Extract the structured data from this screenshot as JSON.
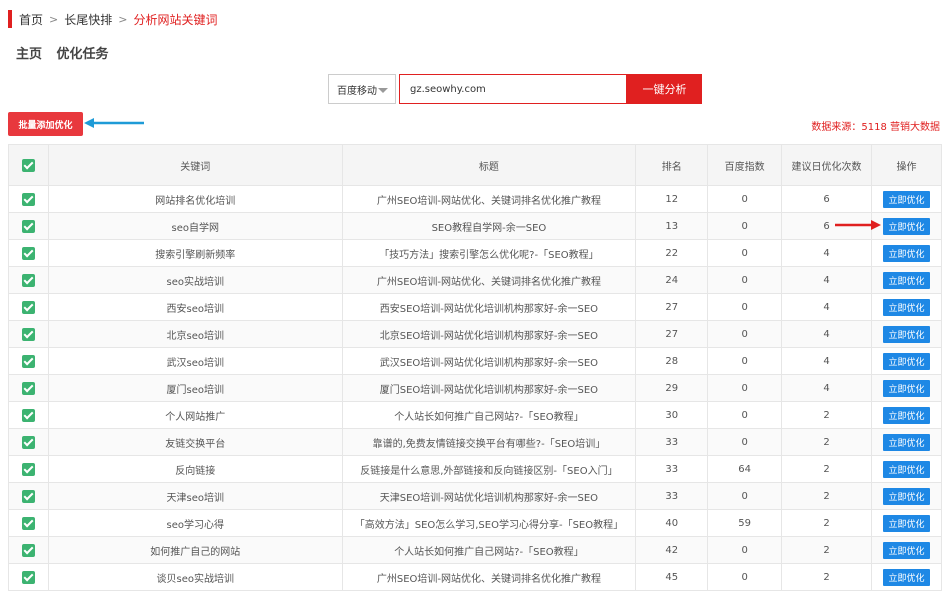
{
  "breadcrumb": {
    "home": "首页",
    "section": "长尾快排",
    "current": "分析网站关键词"
  },
  "page_tabs": [
    "主页",
    "优化任务"
  ],
  "search": {
    "engine": "百度移动",
    "url": "gz.seowhy.com",
    "submit_label": "一键分析"
  },
  "batch_add_label": "批量添加优化",
  "data_source": "数据来源：5118 营销大数据",
  "colors": {
    "accent": "#e02020",
    "action": "#1e88e5",
    "check": "#3cb371",
    "arrow_blue": "#1e9bd7"
  },
  "table": {
    "headers": [
      "关键词",
      "标题",
      "排名",
      "百度指数",
      "建议日优化次数",
      "操作"
    ],
    "action_label": "立即优化",
    "rows": [
      {
        "keyword": "网站排名优化培训",
        "title": "广州SEO培训-网站优化、关键词排名优化推广教程",
        "rank": "12",
        "index": "0",
        "times": "6"
      },
      {
        "keyword": "seo自学网",
        "title": "SEO教程自学网-余一SEO",
        "rank": "13",
        "index": "0",
        "times": "6"
      },
      {
        "keyword": "搜索引擎刷新频率",
        "title": "「技巧方法」搜索引擎怎么优化呢?-「SEO教程」",
        "rank": "22",
        "index": "0",
        "times": "4"
      },
      {
        "keyword": "seo实战培训",
        "title": "广州SEO培训-网站优化、关键词排名优化推广教程",
        "rank": "24",
        "index": "0",
        "times": "4"
      },
      {
        "keyword": "西安seo培训",
        "title": "西安SEO培训-网站优化培训机构那家好-余一SEO",
        "rank": "27",
        "index": "0",
        "times": "4"
      },
      {
        "keyword": "北京seo培训",
        "title": "北京SEO培训-网站优化培训机构那家好-余一SEO",
        "rank": "27",
        "index": "0",
        "times": "4"
      },
      {
        "keyword": "武汉seo培训",
        "title": "武汉SEO培训-网站优化培训机构那家好-余一SEO",
        "rank": "28",
        "index": "0",
        "times": "4"
      },
      {
        "keyword": "厦门seo培训",
        "title": "厦门SEO培训-网站优化培训机构那家好-余一SEO",
        "rank": "29",
        "index": "0",
        "times": "4"
      },
      {
        "keyword": "个人网站推广",
        "title": "个人站长如何推广自己网站?-「SEO教程」",
        "rank": "30",
        "index": "0",
        "times": "2"
      },
      {
        "keyword": "友链交换平台",
        "title": "靠谱的,免费友情链接交换平台有哪些?-「SEO培训」",
        "rank": "33",
        "index": "0",
        "times": "2"
      },
      {
        "keyword": "反向链接",
        "title": "反链接是什么意思,外部链接和反向链接区别-「SEO入门」",
        "rank": "33",
        "index": "64",
        "times": "2"
      },
      {
        "keyword": "天津seo培训",
        "title": "天津SEO培训-网站优化培训机构那家好-余一SEO",
        "rank": "33",
        "index": "0",
        "times": "2"
      },
      {
        "keyword": "seo学习心得",
        "title": "「高效方法」SEO怎么学习,SEO学习心得分享-「SEO教程」",
        "rank": "40",
        "index": "59",
        "times": "2"
      },
      {
        "keyword": "如何推广自己的网站",
        "title": "个人站长如何推广自己网站?-「SEO教程」",
        "rank": "42",
        "index": "0",
        "times": "2"
      },
      {
        "keyword": "谈贝seo实战培训",
        "title": "广州SEO培训-网站优化、关键词排名优化推广教程",
        "rank": "45",
        "index": "0",
        "times": "2"
      }
    ]
  }
}
